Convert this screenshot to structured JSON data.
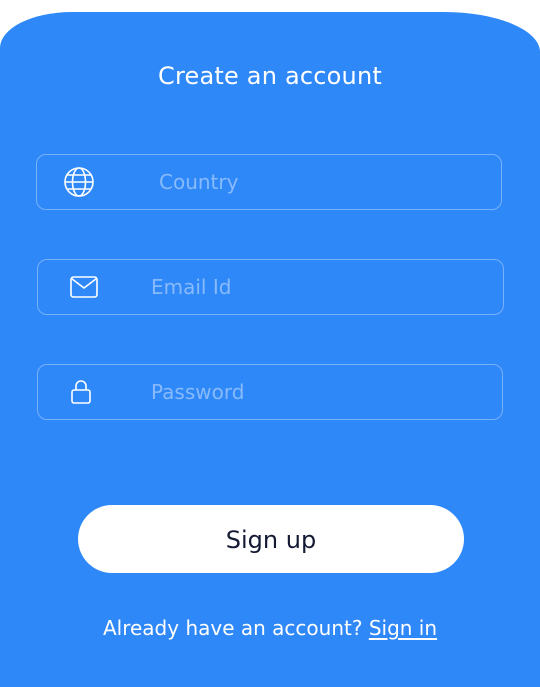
{
  "form": {
    "title": "Create an account",
    "fields": {
      "country": {
        "icon": "globe-icon",
        "placeholder": "Country",
        "value": ""
      },
      "email": {
        "icon": "mail-icon",
        "placeholder": "Email Id",
        "value": ""
      },
      "password": {
        "icon": "lock-icon",
        "placeholder": "Password",
        "value": ""
      }
    },
    "signup_label": "Sign up",
    "footer_text": "Already have an account?",
    "signin_label": "Sign in"
  },
  "colors": {
    "background": "#2f88f8",
    "button_bg": "#ffffff",
    "button_text": "#141a33"
  }
}
